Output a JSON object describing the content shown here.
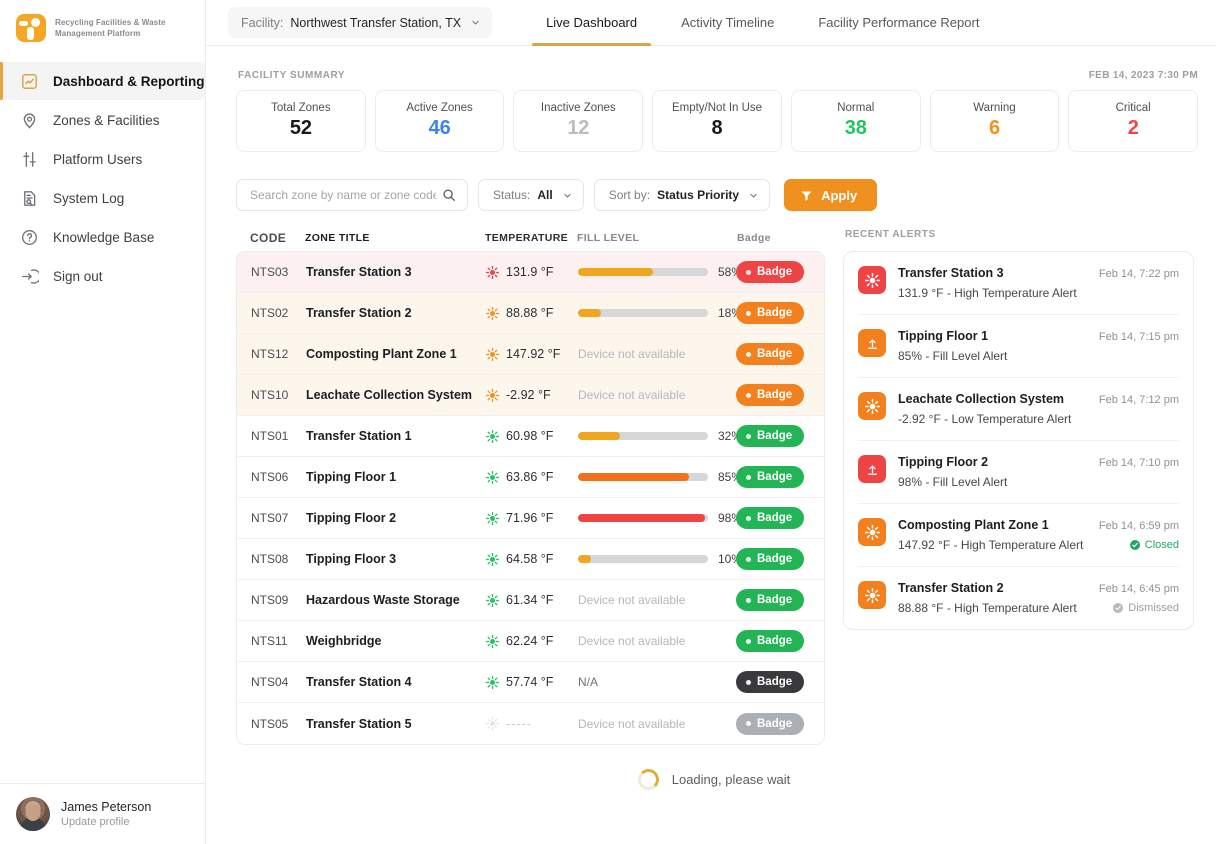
{
  "brand": {
    "line1": "Recycling Facilities & Waste",
    "line2": "Management Platform",
    "logo_icon": "recycling-logo-icon",
    "accent": "#F5A623"
  },
  "sidebar": {
    "items": [
      {
        "label": "Dashboard & Reporting",
        "icon": "chart-report-icon",
        "active": true
      },
      {
        "label": "Zones & Facilities",
        "icon": "map-pin-icon",
        "active": false
      },
      {
        "label": "Platform Users",
        "icon": "sliders-icon",
        "active": false
      },
      {
        "label": "System Log",
        "icon": "document-search-icon",
        "active": false
      },
      {
        "label": "Knowledge Base",
        "icon": "question-circle-icon",
        "active": false
      },
      {
        "label": "Sign out",
        "icon": "sign-out-icon",
        "active": false
      }
    ],
    "user": {
      "name": "James Peterson",
      "action": "Update profile",
      "avatar": "user-avatar"
    }
  },
  "topbar": {
    "facility_label": "Facility:",
    "facility_value": "Northwest Transfer Station, TX",
    "chevron_icon": "chevron-down-icon",
    "tabs": [
      {
        "label": "Live Dashboard",
        "active": true
      },
      {
        "label": "Activity Timeline",
        "active": false
      },
      {
        "label": "Facility Performance Report",
        "active": false
      }
    ]
  },
  "summary": {
    "title": "FACILITY SUMMARY",
    "timestamp": "FEB 14, 2023 7:30 PM",
    "cards": [
      {
        "label": "Total Zones",
        "value": "52",
        "color": "#17191c"
      },
      {
        "label": "Active Zones",
        "value": "46",
        "color": "#3B82F6"
      },
      {
        "label": "Inactive Zones",
        "value": "12",
        "color": "#b9bcc0"
      },
      {
        "label": "Empty/Not In Use",
        "value": "8",
        "color": "#17191c"
      },
      {
        "label": "Normal",
        "value": "38",
        "color": "#22C55E"
      },
      {
        "label": "Warning",
        "value": "6",
        "color": "#F0911F"
      },
      {
        "label": "Critical",
        "value": "2",
        "color": "#EF4444"
      }
    ]
  },
  "filters": {
    "search_placeholder": "Search zone by name or zone code",
    "search_value": "",
    "search_icon": "search-icon",
    "status_label": "Status:",
    "status_value": "All",
    "sort_label": "Sort by:",
    "sort_value": "Status Priority",
    "apply_label": "Apply",
    "apply_icon": "filter-funnel-icon",
    "apply_color": "#F0911F"
  },
  "table": {
    "headers": [
      "CODE",
      "ZONE TITLE",
      "TEMPERATURE",
      "FILL LEVEL",
      "Badge"
    ],
    "badge_label": "Badge",
    "rows": [
      {
        "code": "NTS03",
        "title": "Transfer Station 3",
        "temp": "131.9 °F",
        "temp_color": "#EF4444",
        "fill_text": "",
        "fill_pct": 58,
        "fill_color": "#F0A61F",
        "pct_label": "58%",
        "badge_color": "#EF4444",
        "row_tint": "crit"
      },
      {
        "code": "NTS02",
        "title": "Transfer Station 2",
        "temp": "88.88 °F",
        "temp_color": "#F0911F",
        "fill_text": "",
        "fill_pct": 18,
        "fill_color": "#F0A61F",
        "pct_label": "18%",
        "badge_color": "#F2801E",
        "row_tint": "warn"
      },
      {
        "code": "NTS12",
        "title": "Composting Plant Zone 1",
        "temp": "147.92 °F",
        "temp_color": "#F0911F",
        "fill_text": "Device not available",
        "fill_pct": null,
        "fill_color": "",
        "pct_label": "",
        "badge_color": "#F2801E",
        "row_tint": "warn"
      },
      {
        "code": "NTS10",
        "title": "Leachate Collection System",
        "temp": "-2.92 °F",
        "temp_color": "#F0911F",
        "fill_text": "Device not available",
        "fill_pct": null,
        "fill_color": "",
        "pct_label": "",
        "badge_color": "#F2801E",
        "row_tint": "warn"
      },
      {
        "code": "NTS01",
        "title": "Transfer Station 1",
        "temp": "60.98 °F",
        "temp_color": "#22C55E",
        "fill_text": "",
        "fill_pct": 32,
        "fill_color": "#F0A61F",
        "pct_label": "32%",
        "badge_color": "#22B455",
        "row_tint": "none"
      },
      {
        "code": "NTS06",
        "title": "Tipping Floor 1",
        "temp": "63.86 °F",
        "temp_color": "#22C55E",
        "fill_text": "",
        "fill_pct": 85,
        "fill_color": "#F2711C",
        "pct_label": "85%",
        "badge_color": "#22B455",
        "row_tint": "none"
      },
      {
        "code": "NTS07",
        "title": "Tipping Floor 2",
        "temp": "71.96 °F",
        "temp_color": "#22C55E",
        "fill_text": "",
        "fill_pct": 98,
        "fill_color": "#EF4444",
        "pct_label": "98%",
        "badge_color": "#22B455",
        "row_tint": "none"
      },
      {
        "code": "NTS08",
        "title": "Tipping Floor 3",
        "temp": "64.58 °F",
        "temp_color": "#22C55E",
        "fill_text": "",
        "fill_pct": 10,
        "fill_color": "#F0A61F",
        "pct_label": "10%",
        "badge_color": "#22B455",
        "row_tint": "none"
      },
      {
        "code": "NTS09",
        "title": "Hazardous Waste Storage",
        "temp": "61.34 °F",
        "temp_color": "#22C55E",
        "fill_text": "Device not available",
        "fill_pct": null,
        "fill_color": "",
        "pct_label": "",
        "badge_color": "#22B455",
        "row_tint": "none"
      },
      {
        "code": "NTS11",
        "title": "Weighbridge",
        "temp": "62.24 °F",
        "temp_color": "#22C55E",
        "fill_text": "Device not available",
        "fill_pct": null,
        "fill_color": "",
        "pct_label": "",
        "badge_color": "#22B455",
        "row_tint": "none"
      },
      {
        "code": "NTS04",
        "title": "Transfer Station 4",
        "temp": "57.74 °F",
        "temp_color": "#22C55E",
        "fill_text": "N/A",
        "fill_pct": null,
        "fill_color": "",
        "pct_label": "",
        "badge_color": "#3A3A3C",
        "row_tint": "none"
      },
      {
        "code": "NTS05",
        "title": "Transfer Station 5",
        "temp": "-----",
        "temp_color": "#e3e5e7",
        "fill_text": "Device not available",
        "fill_pct": null,
        "fill_color": "",
        "pct_label": "",
        "badge_color": "#ACAFB3",
        "row_tint": "none"
      }
    ]
  },
  "alerts": {
    "title": "RECENT ALERTS",
    "items": [
      {
        "name": "Transfer Station 3",
        "desc": "131.9 °F - High Temperature Alert",
        "time": "Feb 14, 7:22 pm",
        "icon": "temperature-sun-icon",
        "icon_color": "#EF4444",
        "status": "",
        "status_icon": ""
      },
      {
        "name": "Tipping Floor 1",
        "desc": "85% - Fill Level Alert",
        "time": "Feb 14, 7:15 pm",
        "icon": "fill-level-up-icon",
        "icon_color": "#F2801E",
        "status": "",
        "status_icon": ""
      },
      {
        "name": "Leachate Collection System",
        "desc": "-2.92 °F - Low Temperature Alert",
        "time": "Feb 14, 7:12 pm",
        "icon": "temperature-sun-icon",
        "icon_color": "#F2801E",
        "status": "",
        "status_icon": ""
      },
      {
        "name": "Tipping Floor 2",
        "desc": "98% - Fill Level Alert",
        "time": "Feb 14, 7:10 pm",
        "icon": "fill-level-up-icon",
        "icon_color": "#EF4444",
        "status": "",
        "status_icon": ""
      },
      {
        "name": "Composting Plant Zone 1",
        "desc": "147.92 °F - High Temperature Alert",
        "time": "Feb 14, 6:59 pm",
        "icon": "temperature-sun-icon",
        "icon_color": "#F2801E",
        "status": "Closed",
        "status_icon": "check-circle-icon"
      },
      {
        "name": "Transfer Station 2",
        "desc": "88.88 °F - High Temperature Alert",
        "time": "Feb 14, 6:45 pm",
        "icon": "temperature-sun-icon",
        "icon_color": "#F2801E",
        "status": "Dismissed",
        "status_icon": "dismiss-circle-icon"
      }
    ]
  },
  "loading": {
    "text": "Loading, please wait",
    "icon": "spinner-icon"
  }
}
